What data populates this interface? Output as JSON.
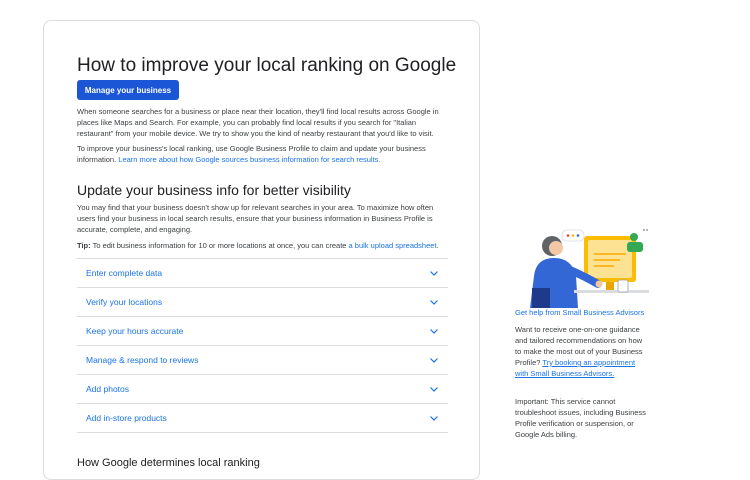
{
  "main": {
    "title": "How to improve your local ranking on Google",
    "manage_button": "Manage your business",
    "intro": "When someone searches for a business or place near their location, they'll find local results across Google in places like Maps and Search. For example, you can probably find local results if you search for \"Italian restaurant\" from your mobile device. We try to show you the kind of nearby restaurant that you'd like to visit.",
    "para2_text": "To improve your business's local ranking, use Google Business Profile to claim and update your business information.",
    "para2_link": "Learn more about how Google sources business information for search results.",
    "section_title": "Update your business info for better visibility",
    "section_body": "You may find that your business doesn't show up for relevant searches in your area. To maximize how often users find your business in local search results, ensure that your business information in Business Profile is accurate, complete, and engaging.",
    "tip_label": "Tip:",
    "tip_text": "To edit business information for 10 or more locations at once, you can create",
    "tip_link": "a bulk upload spreadsheet",
    "tip_end": ".",
    "accordion": [
      {
        "label": "Enter complete data"
      },
      {
        "label": "Verify your locations"
      },
      {
        "label": "Keep your hours accurate"
      },
      {
        "label": "Manage & respond to reviews"
      },
      {
        "label": "Add photos"
      },
      {
        "label": "Add in-store products"
      }
    ],
    "next_heading": "How Google determines local ranking"
  },
  "sidebar": {
    "title": "Get help from Small Business Advisors",
    "desc_text": "Want to receive one-on-one guidance and tailored recommendations on how to make the most out of your Business Profile?",
    "desc_link": "Try booking an appointment with Small Business Advisors.",
    "note": "Important: This service cannot troubleshoot issues, including Business Profile verification or suspension, or Google Ads billing."
  },
  "colors": {
    "accent": "#1a73e8",
    "button": "#1a56d6"
  }
}
